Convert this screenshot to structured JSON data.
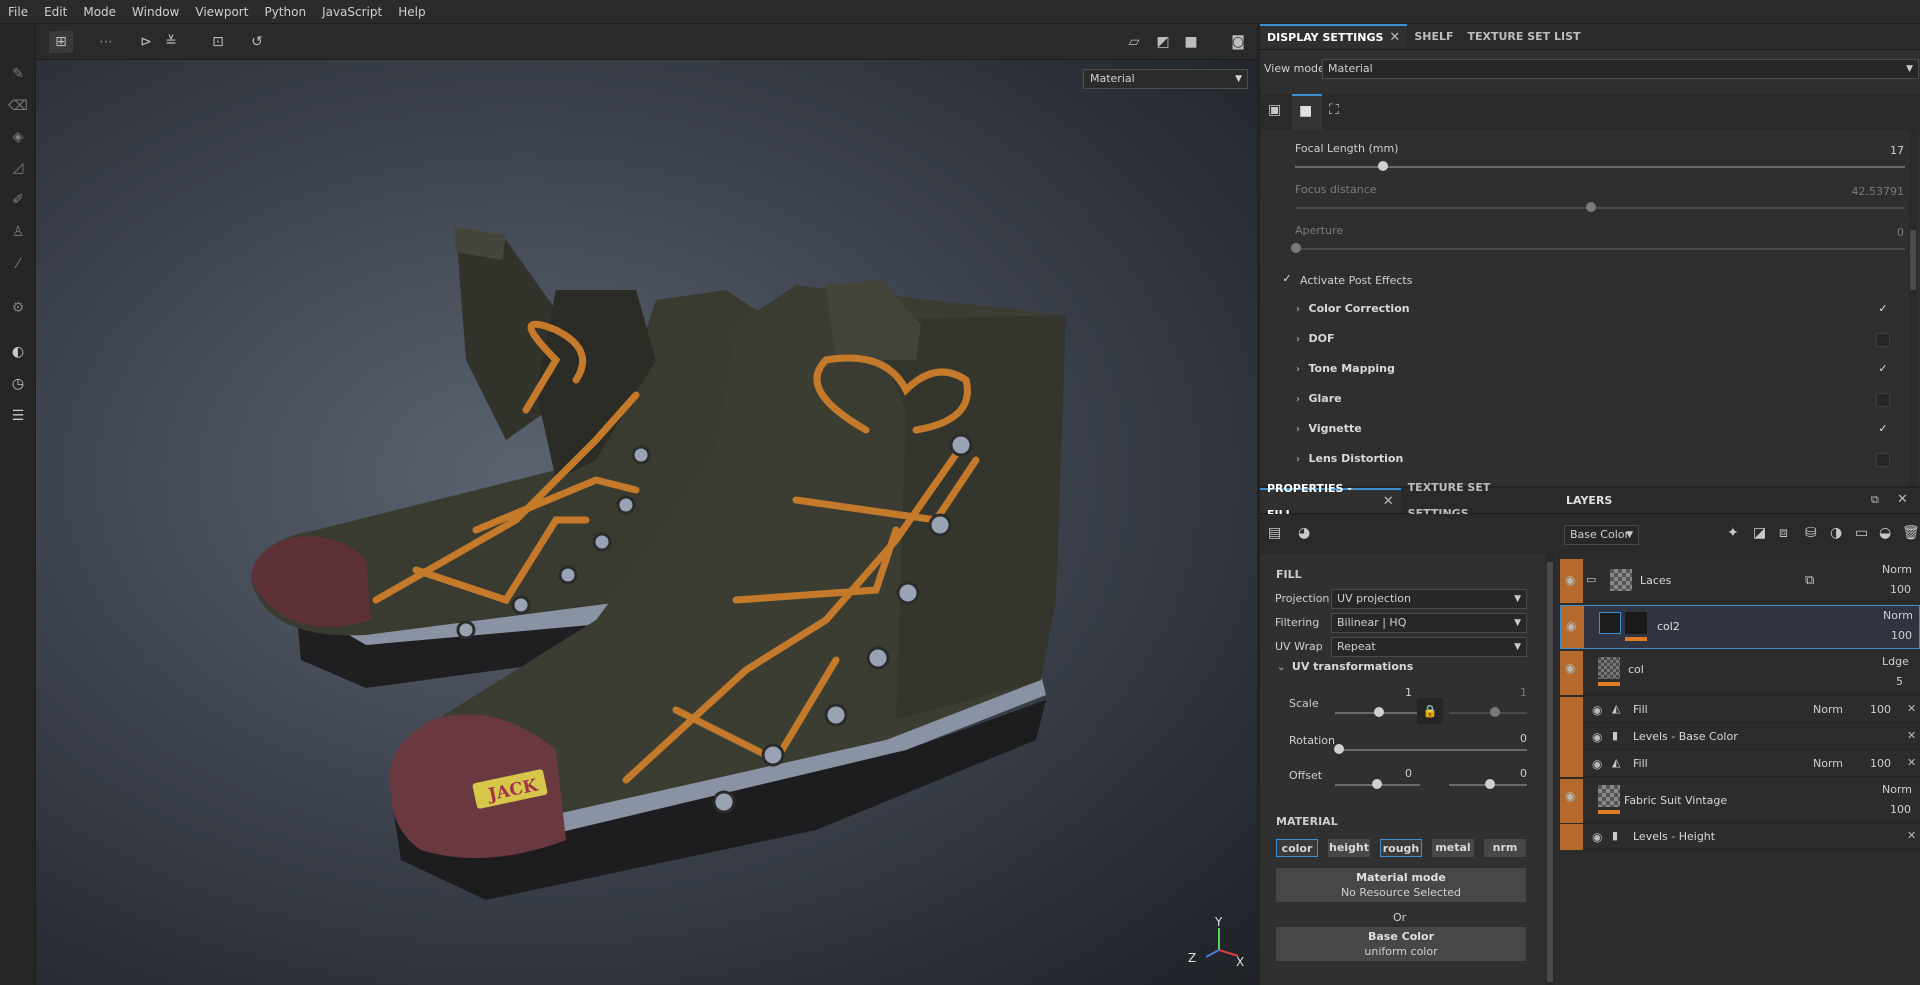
{
  "menu": [
    "File",
    "Edit",
    "Mode",
    "Window",
    "Viewport",
    "Python",
    "JavaScript",
    "Help"
  ],
  "viewport": {
    "view_dropdown": "Material",
    "axis": {
      "y": "Y",
      "z": "Z",
      "x": "X"
    },
    "label_text": "JACK"
  },
  "display": {
    "tabs": [
      {
        "label": "DISPLAY SETTINGS",
        "closable": true
      },
      {
        "label": "SHELF"
      },
      {
        "label": "TEXTURE SET LIST"
      }
    ],
    "view_mode_label": "View mode",
    "view_mode_value": "Material",
    "focal_length_label": "Focal Length (mm)",
    "focal_length_value": "17",
    "focus_distance_label": "Focus distance",
    "focus_distance_value": "42.53791",
    "aperture_label": "Aperture",
    "aperture_value": "0",
    "activate_post_effects": "Activate Post Effects",
    "effects": [
      {
        "label": "Color Correction",
        "checked": true
      },
      {
        "label": "DOF",
        "checked": false
      },
      {
        "label": "Tone Mapping",
        "checked": true
      },
      {
        "label": "Glare",
        "checked": false
      },
      {
        "label": "Vignette",
        "checked": true
      },
      {
        "label": "Lens Distortion",
        "checked": false
      }
    ]
  },
  "properties": {
    "tabs": [
      {
        "label": "PROPERTIES - FILL",
        "closable": true
      },
      {
        "label": "TEXTURE SET SETTINGS"
      }
    ],
    "fill_header": "FILL",
    "projection_label": "Projection",
    "projection_value": "UV projection",
    "filtering_label": "Filtering",
    "filtering_value": "Bilinear | HQ",
    "uvwrap_label": "UV Wrap",
    "uvwrap_value": "Repeat",
    "uv_transformations": "UV transformations",
    "scale_label": "Scale",
    "scale_value": "1",
    "scale_value2": "1",
    "rotation_label": "Rotation",
    "rotation_value": "0",
    "offset_label": "Offset",
    "offset_value1": "0",
    "offset_value2": "0",
    "material_header": "MATERIAL",
    "channels": [
      {
        "label": "color",
        "selected": true
      },
      {
        "label": "height",
        "selected": false
      },
      {
        "label": "rough",
        "selected": true
      },
      {
        "label": "metal",
        "selected": false
      },
      {
        "label": "nrm",
        "selected": false
      }
    ],
    "material_mode_title": "Material mode",
    "material_mode_sub": "No Resource Selected",
    "or_label": "Or",
    "base_color_title": "Base Color",
    "base_color_sub": "uniform color"
  },
  "layers": {
    "title": "LAYERS",
    "channel_dropdown": "Base Color",
    "rows": [
      {
        "name": "Laces",
        "blend": "Norm",
        "opacity": "100"
      },
      {
        "name": "col2",
        "blend": "Norm",
        "opacity": "100"
      },
      {
        "name": "col",
        "blend": "Ldge",
        "opacity": "5"
      },
      {
        "name": "Fill",
        "blend": "Norm",
        "opacity": "100"
      },
      {
        "name": "Levels - Base Color"
      },
      {
        "name": "Fill",
        "blend": "Norm",
        "opacity": "100"
      },
      {
        "name": "Fabric Suit Vintage",
        "blend": "Norm",
        "opacity": "100"
      },
      {
        "name": "Levels - Height"
      }
    ]
  },
  "colors": {
    "accent": "#3e8ed0",
    "layer_orange": "#b36a2c",
    "shoe_canvas": "#3d3f33",
    "laces": "#c47a2a",
    "toe_cap": "#6a3940"
  }
}
